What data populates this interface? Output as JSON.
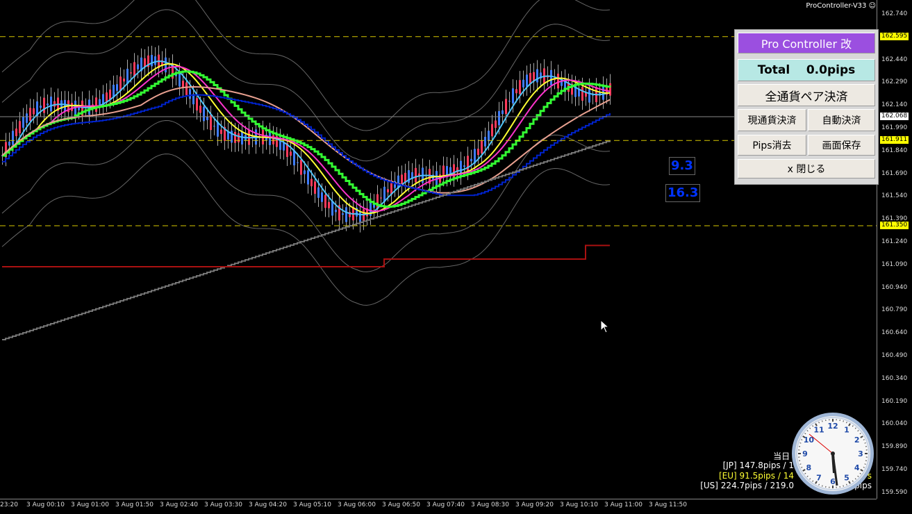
{
  "window": {
    "title": "ProController-V33 ☺"
  },
  "price_axis": {
    "labels": [
      "162.740",
      "162.440",
      "162.290",
      "162.140",
      "161.990",
      "161.840",
      "161.690",
      "161.540",
      "161.390",
      "161.240",
      "161.090",
      "160.940",
      "160.790",
      "160.640",
      "160.490",
      "160.340",
      "160.190",
      "160.040",
      "159.890",
      "159.740",
      "159.590"
    ],
    "tags": [
      {
        "text": "162.595",
        "color": "#ffff00"
      },
      {
        "text": "162.068",
        "color": "#ffffff"
      },
      {
        "text": "161.911",
        "color": "#ffff00"
      },
      {
        "text": "161.350",
        "color": "#ffff00"
      }
    ]
  },
  "time_axis": {
    "labels": [
      "23:20",
      "3 Aug 00:10",
      "3 Aug 01:00",
      "3 Aug 01:50",
      "3 Aug 02:40",
      "3 Aug 03:30",
      "3 Aug 04:20",
      "3 Aug 05:10",
      "3 Aug 06:00",
      "3 Aug 06:50",
      "3 Aug 07:40",
      "3 Aug 08:30",
      "3 Aug 09:20",
      "3 Aug 10:10",
      "3 Aug 11:00",
      "3 Aug 11:50"
    ]
  },
  "panel": {
    "header": "Pro Controller 改",
    "total": "Total    0.0pips",
    "close_all": "全通貨ペア決済",
    "close_current": "現通貨決済",
    "auto_close": "自動決済",
    "clear_pips": "Pips消去",
    "save_screen": "画面保存",
    "close": "x 閉じる",
    "colors": {
      "header_bg": "#9b4fe0",
      "total_bg": "#b7e8e4"
    }
  },
  "markers": {
    "value_a": "9.3",
    "value_b": "16.3"
  },
  "stats": {
    "today_label": "当日 /",
    "jp": "[JP] 147.8pips / 1",
    "eu": "[EU] 91.5pips / 14",
    "eu_suffix": "s",
    "us": "[US] 224.7pips / 219.0",
    "us_suffix": "pips"
  },
  "clock": {
    "numbers": [
      "12",
      "1",
      "2",
      "3",
      "4",
      "5",
      "6",
      "7",
      "8",
      "9",
      "10",
      "11"
    ]
  }
}
